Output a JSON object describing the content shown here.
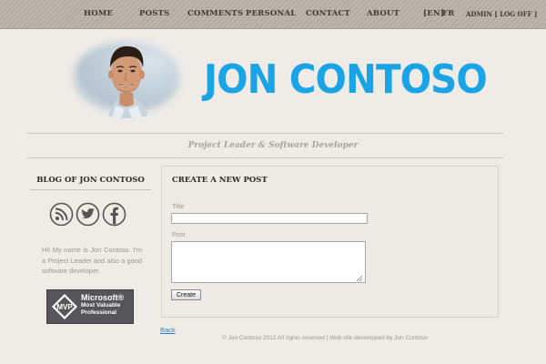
{
  "nav": {
    "items": [
      {
        "label": "HOME"
      },
      {
        "label": "POSTS"
      },
      {
        "label": "COMMENTS"
      },
      {
        "label": "PERSONAL"
      },
      {
        "label": "CONTACT"
      },
      {
        "label": "ABOUT"
      }
    ],
    "lang_en": "[EN]",
    "lang_fr": "FR",
    "admin": "ADMIN",
    "logoff": "[ LOG OFF ]"
  },
  "header": {
    "site_title": "JON CONTOSO",
    "tagline": "Project Leader & Software Developer",
    "title_color": "#1aa4e6"
  },
  "sidebar": {
    "title": "BLOG OF JON CONTOSO",
    "social_icons": [
      "rss-icon",
      "twitter-icon",
      "facebook-icon"
    ],
    "bio": "Hi! My name is Jon Contoso. I'm a Project Leader and also a good software developer.",
    "badge": {
      "logo_text": "MVP",
      "brand": "Microsoft®",
      "line1": "Most Valuable",
      "line2": "Professional"
    }
  },
  "main": {
    "heading": "CREATE A NEW POST",
    "title_label": "Title",
    "title_value": "",
    "post_label": "Post",
    "post_value": "",
    "create_label": "Create",
    "back_label": "Back"
  },
  "footer": {
    "text": "© Jon Contoso 2012 All rights reserved | Web site developped by Jon Contoso"
  }
}
